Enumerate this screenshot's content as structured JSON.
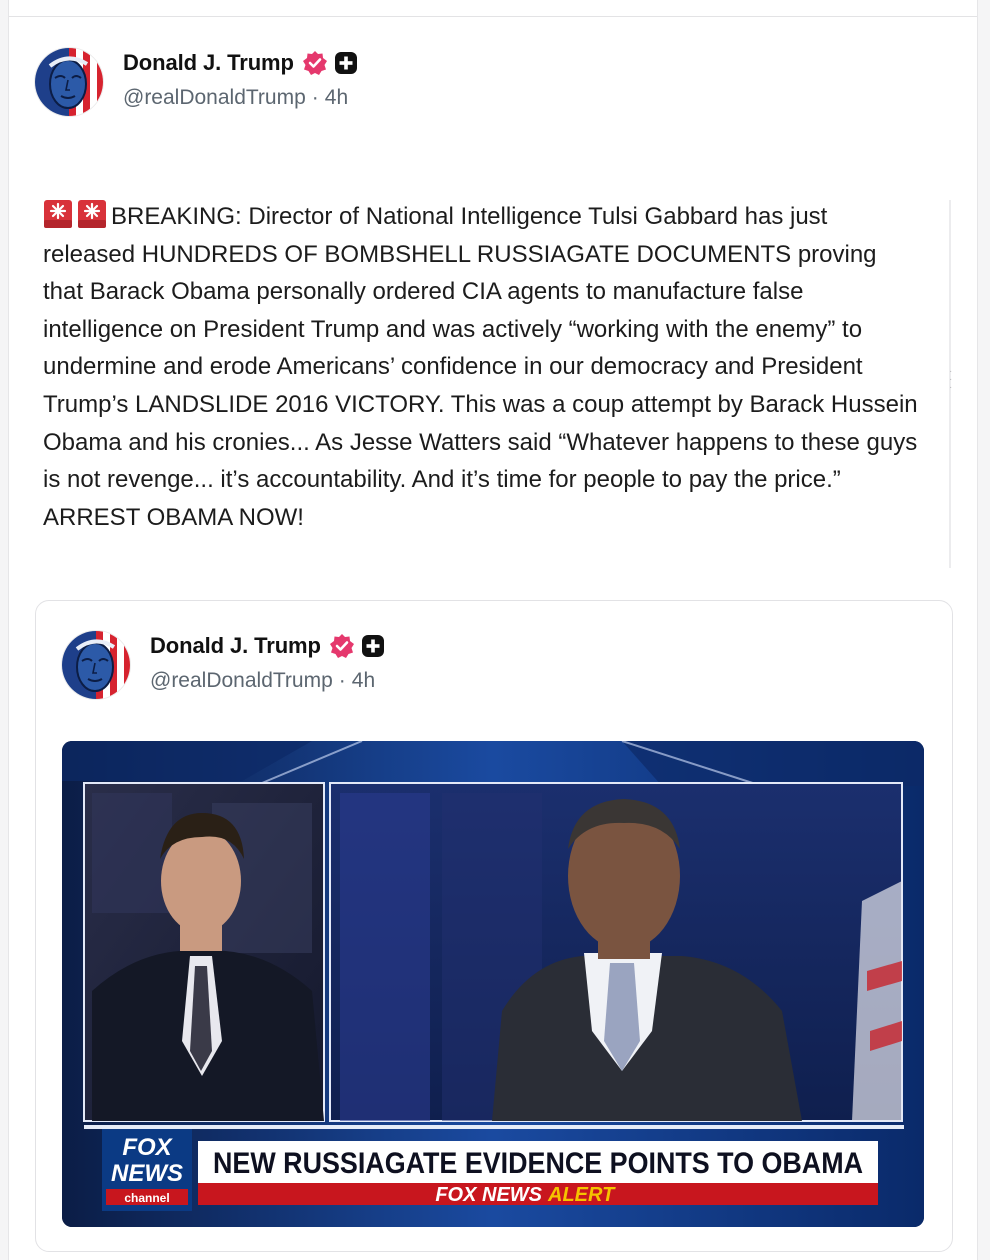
{
  "post": {
    "author_name": "Donald J. Trump",
    "handle": "@realDonaldTrump",
    "separator": "·",
    "time": "4h",
    "text": "BREAKING: Director of National Intelligence Tulsi Gabbard has just released HUNDREDS OF BOMBSHELL RUSSIAGATE DOCUMENTS proving that Barack Obama personally ordered CIA agents to manufacture false intelligence on President Trump and was actively “working with the enemy” to undermine and erode Americans’ confidence in our democracy and President Trump’s LANDSLIDE 2016 VICTORY. This was a coup attempt by Barack Hussein Obama and his cronies... As Jesse Watters said “Whatever happens to these guys is not revenge... it’s accountability. And it’s time for people to pay the price.” ARREST OBAMA NOW!",
    "lead_icons": [
      "siren-icon",
      "siren-icon"
    ]
  },
  "quoted_post": {
    "author_name": "Donald J. Trump",
    "handle": "@realDonaldTrump",
    "separator": "·",
    "time": "4h",
    "video": {
      "network_logo_line1": "FOX",
      "network_logo_line2": "NEWS",
      "network_logo_line3": "channel",
      "headline": "NEW RUSSIAGATE EVIDENCE POINTS TO OBAMA",
      "alert_prefix": "FOX NEWS",
      "alert_word": "ALERT"
    }
  },
  "colors": {
    "verified_badge": "#e5386d",
    "text": "#1c1c1c",
    "muted": "#5c6670",
    "alert_red": "#c8161e",
    "alert_yellow": "#f5c400",
    "fox_blue": "#0b3a84"
  },
  "icons": {
    "verified": "verified-badge-icon",
    "plus": "plus-badge-icon"
  }
}
